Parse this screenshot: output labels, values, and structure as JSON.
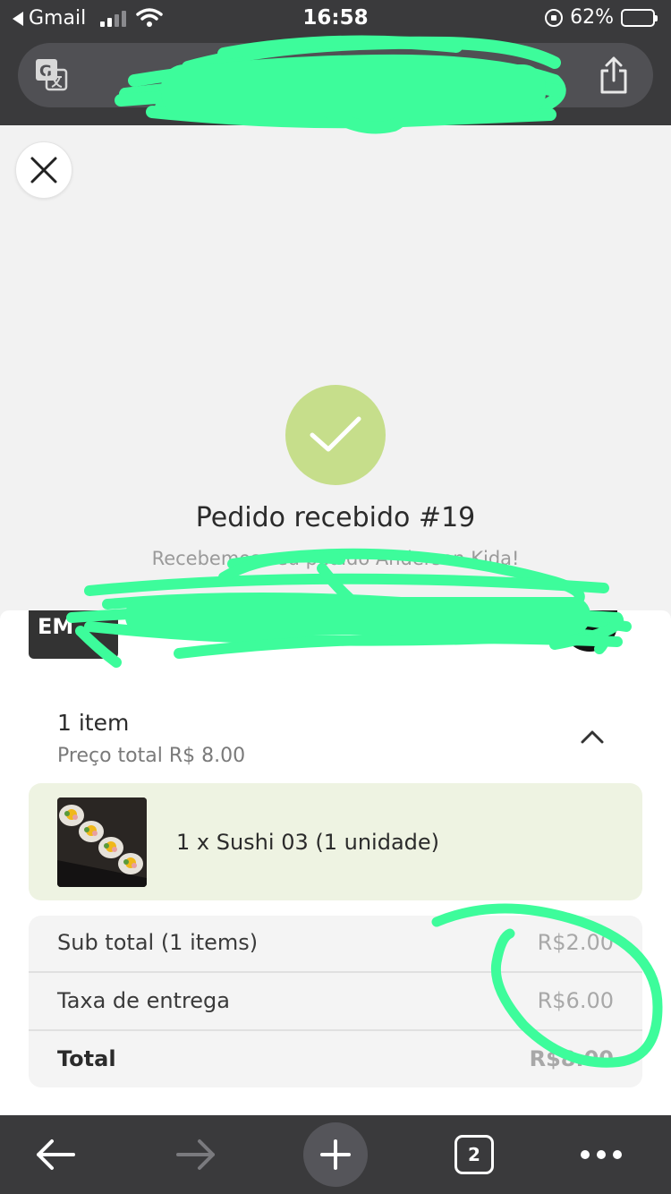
{
  "status_bar": {
    "back_app": "Gmail",
    "time": "16:58",
    "battery": "62%",
    "battery_level": 0.62,
    "signal_bars": 2
  },
  "browser": {
    "url_hidden": true,
    "open_tabs": "2"
  },
  "order": {
    "title": "Pedido recebido #19",
    "subtitle": "Recebemos seu pedido Anderson Kida!",
    "success_color": "#c6de8b"
  },
  "store": {
    "logo_text": "EM"
  },
  "items": {
    "count_label": "1 item",
    "total_label": "Preço total R$ 8.00",
    "list": [
      {
        "name": "1 x Sushi 03 (1 unidade)"
      }
    ]
  },
  "summary": {
    "rows": [
      {
        "label": "Sub total (1 items)",
        "value": "R$2.00"
      },
      {
        "label": "Taxa de entrega",
        "value": "R$6.00"
      },
      {
        "label": "Total",
        "value": "R$8.00"
      }
    ]
  },
  "colors": {
    "item_card_bg": "#eef3e2",
    "scribble": "#3dfc9b"
  }
}
